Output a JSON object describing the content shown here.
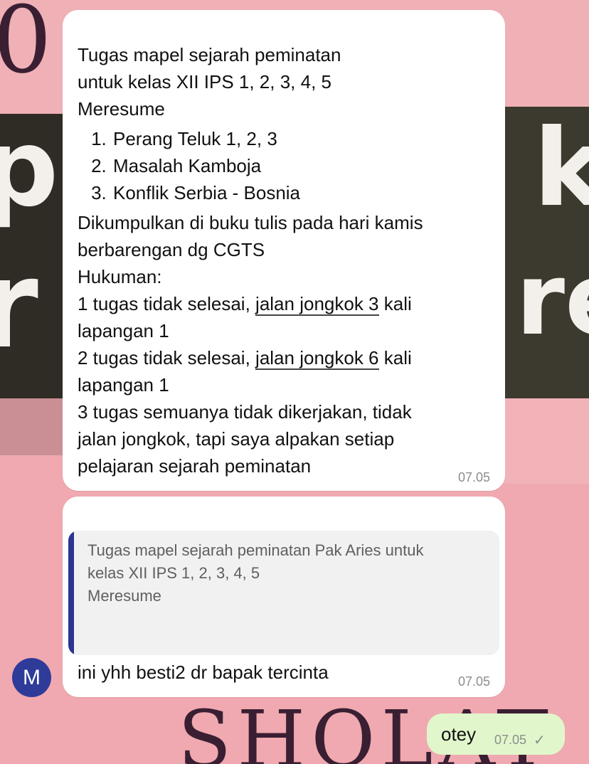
{
  "messages": [
    {
      "lines_top": [
        "Tugas mapel sejarah peminatan",
        "untuk kelas XII IPS 1, 2, 3, 4, 5",
        "Meresume"
      ],
      "list": [
        "Perang Teluk 1, 2, 3",
        "Masalah Kamboja",
        "Konflik Serbia - Bosnia"
      ],
      "lines_bottom": {
        "l1": "Dikumpulkan di buku tulis pada hari kamis",
        "l2": "berbarengan dg CGTS",
        "l3": "Hukuman:",
        "l4_pre": "1 tugas tidak selesai, ",
        "l4_link": "jalan jongkok 3",
        "l4_post": " kali",
        "l5": "lapangan 1",
        "l6_pre": "2 tugas tidak selesai, ",
        "l6_link": "jalan jongkok 6",
        "l6_post": " kali",
        "l7": "lapangan 1",
        "l8": "3 tugas semuanya tidak dikerjakan, tidak",
        "l9": "jalan jongkok, tapi saya alpakan setiap",
        "l10": "pelajaran sejarah peminatan"
      },
      "time": "07.05"
    },
    {
      "quote_lines": [
        "Tugas mapel sejarah peminatan Pak Aries untuk",
        "kelas XII IPS 1, 2, 3, 4, 5",
        "Meresume"
      ],
      "text": "ini yhh besti2 dr bapak tercinta",
      "time": "07.05",
      "avatar_letter": "M"
    },
    {
      "text": "otey",
      "time": "07.05",
      "status_icon": "single-check-icon"
    }
  ],
  "wallpaper": {
    "glyph_p": "p",
    "glyph_k": "k",
    "glyph_r": "r",
    "glyph_re": "re",
    "scribble_top": "0",
    "scribble_bottom": "SHOLAT"
  },
  "colors": {
    "avatar": "#2f3b98",
    "quote_bar": "#2e3492",
    "outgoing_bubble": "#e1f7cb",
    "incoming_bubble": "#ffffff"
  }
}
